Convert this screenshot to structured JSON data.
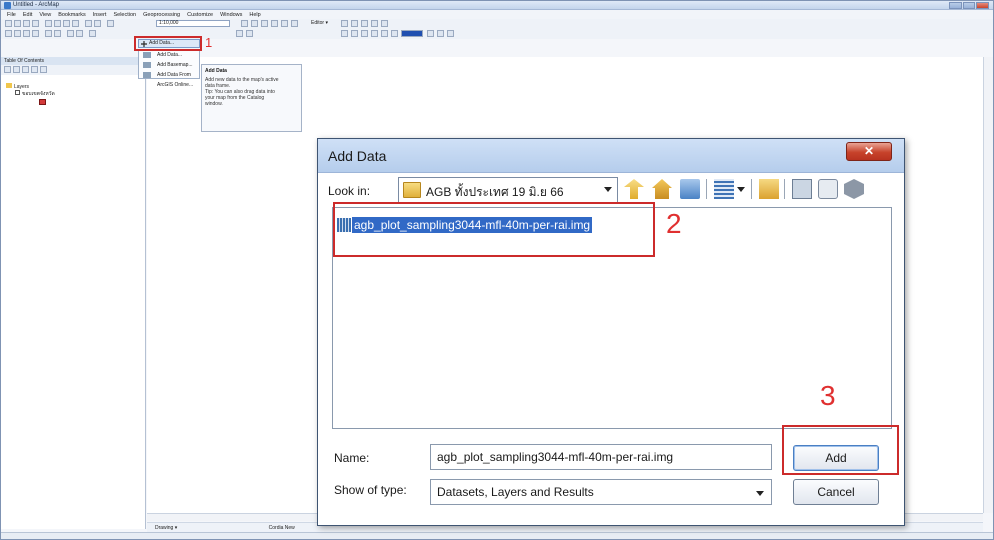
{
  "window": {
    "title": "Untitled - ArcMap"
  },
  "menubar": {
    "items": [
      "File",
      "Edit",
      "View",
      "Bookmarks",
      "Insert",
      "Selection",
      "Geoprocessing",
      "Customize",
      "Windows",
      "Help"
    ]
  },
  "toolbar": {
    "scale": "1:10,000",
    "add_data_label": "Add Data...",
    "editor_label": "Editor ▾"
  },
  "add_data_menu": {
    "items": [
      "Add Data...",
      "Add Basemap...",
      "Add Data From ArcGIS Online..."
    ]
  },
  "tooltip": {
    "title": "Add Data",
    "lines": [
      "Add new data to the map's active",
      "data frame.",
      "",
      "Tip: You can also drag data into",
      "your map from the Catalog",
      "window."
    ]
  },
  "toc": {
    "title": "Table Of Contents",
    "layers_label": "Layers",
    "layer_name": "ขอบเขตจังหวัด"
  },
  "drawing_toolbar": {
    "label": "Drawing ▾",
    "font": "Cordia New"
  },
  "annotations": {
    "step1": "1",
    "step2": "2",
    "step3": "3"
  },
  "dialog": {
    "title": "Add Data",
    "close_symbol": "✕",
    "look_in_label": "Look in:",
    "look_in_value": "AGB ทั้งประเทศ 19 มิ.ย 66",
    "files": [
      "agb_plot_sampling3044-mfl-40m-per-rai.img"
    ],
    "name_label": "Name:",
    "name_value": "agb_plot_sampling3044-mfl-40m-per-rai.img",
    "type_label": "Show of type:",
    "type_value": "Datasets, Layers and Results",
    "add_button": "Add",
    "cancel_button": "Cancel"
  },
  "colors": {
    "selection": "#3169c6",
    "annotation_red": "#cc2b2b",
    "title_gradient_top": "#cfe0f6"
  }
}
